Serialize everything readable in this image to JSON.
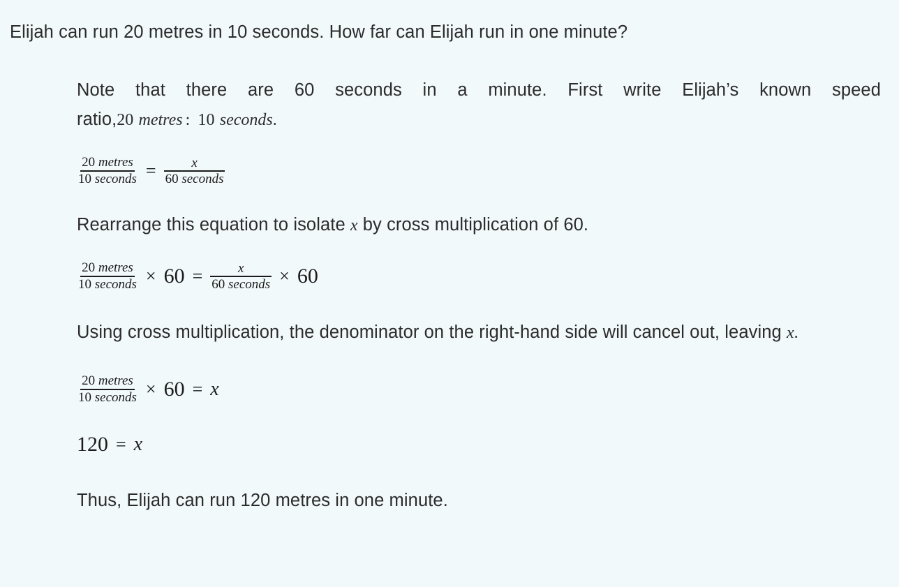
{
  "question": "Elijah can run 20 metres in 10 seconds. How far can Elijah run in one minute?",
  "solution": {
    "intro": {
      "text_before": "Note that there are 60 seconds in a minute. First write Elijah’s known speed ratio,",
      "ratio_value_1": "20",
      "ratio_unit_1": "metres",
      "ratio_separator": ":",
      "ratio_value_2": "10",
      "ratio_unit_2": "seconds",
      "ratio_period": "."
    },
    "equation_1": {
      "left_numerator_value": "20",
      "left_numerator_unit": "metres",
      "left_denominator_value": "10",
      "left_denominator_unit": "seconds",
      "relation": "=",
      "right_numerator": "x",
      "right_denominator_value": "60",
      "right_denominator_unit": "seconds"
    },
    "rearrange_text": {
      "before": "Rearrange this equation to isolate",
      "variable": "x",
      "after": "by cross multiplication of 60."
    },
    "equation_2": {
      "left_numerator_value": "20",
      "left_numerator_unit": "metres",
      "left_denominator_value": "10",
      "left_denominator_unit": "seconds",
      "multiply_sign_left": "×",
      "multiplier_left": "60",
      "relation": "=",
      "right_numerator": "x",
      "right_denominator_value": "60",
      "right_denominator_unit": "seconds",
      "multiply_sign_right": "×",
      "multiplier_right": "60"
    },
    "cancel_text": {
      "before": "Using cross multiplication, the denominator on the right-hand side will cancel out, leaving",
      "variable": "x",
      "after": "."
    },
    "equation_3": {
      "numerator_value": "20",
      "numerator_unit": "metres",
      "denominator_value": "10",
      "denominator_unit": "seconds",
      "multiply_sign": "×",
      "multiplier": "60",
      "relation": "=",
      "result_variable": "x"
    },
    "equation_4": {
      "value": "120",
      "relation": "=",
      "variable": "x"
    },
    "conclusion": "Thus, Elijah can run 120 metres in one minute."
  },
  "colors": {
    "background": "#f2f9fb",
    "text": "#2b2b2b",
    "math": "#1b1b1b"
  }
}
